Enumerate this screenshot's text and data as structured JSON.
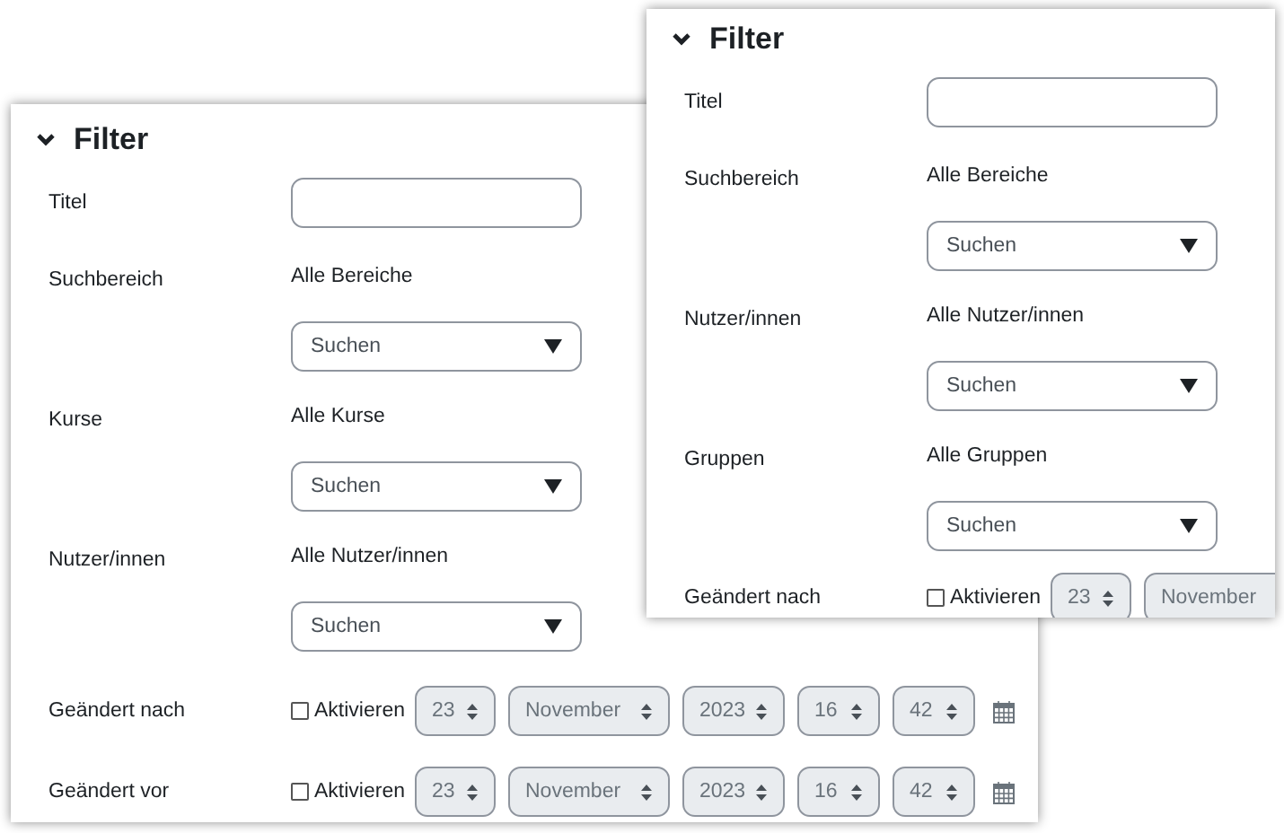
{
  "panels": [
    {
      "title": "Filter",
      "rows": [
        {
          "kind": "text",
          "label": "Titel"
        },
        {
          "kind": "scope",
          "label": "Suchbereich",
          "value": "Alle Bereiche",
          "select": "Suchen"
        },
        {
          "kind": "scope",
          "label": "Kurse",
          "value": "Alle Kurse",
          "select": "Suchen"
        },
        {
          "kind": "scope",
          "label": "Nutzer/innen",
          "value": "Alle Nutzer/innen",
          "select": "Suchen"
        },
        {
          "kind": "date",
          "label": "Geändert nach",
          "checkbox_label": "Aktivieren",
          "checked": false,
          "fields": [
            "23",
            "November",
            "2023",
            "16",
            "42"
          ],
          "calendar": true
        },
        {
          "kind": "date",
          "label": "Geändert vor",
          "checkbox_label": "Aktivieren",
          "checked": false,
          "fields": [
            "23",
            "November",
            "2023",
            "16",
            "42"
          ],
          "calendar": true
        }
      ]
    },
    {
      "title": "Filter",
      "rows": [
        {
          "kind": "text",
          "label": "Titel"
        },
        {
          "kind": "scope",
          "label": "Suchbereich",
          "value": "Alle Bereiche",
          "select": "Suchen"
        },
        {
          "kind": "scope",
          "label": "Nutzer/innen",
          "value": "Alle Nutzer/innen",
          "select": "Suchen"
        },
        {
          "kind": "scope",
          "label": "Gruppen",
          "value": "Alle Gruppen",
          "select": "Suchen"
        },
        {
          "kind": "date",
          "label": "Geändert nach",
          "checkbox_label": "Aktivieren",
          "checked": false,
          "fields": [
            "23",
            "November"
          ],
          "calendar": false
        }
      ]
    }
  ]
}
